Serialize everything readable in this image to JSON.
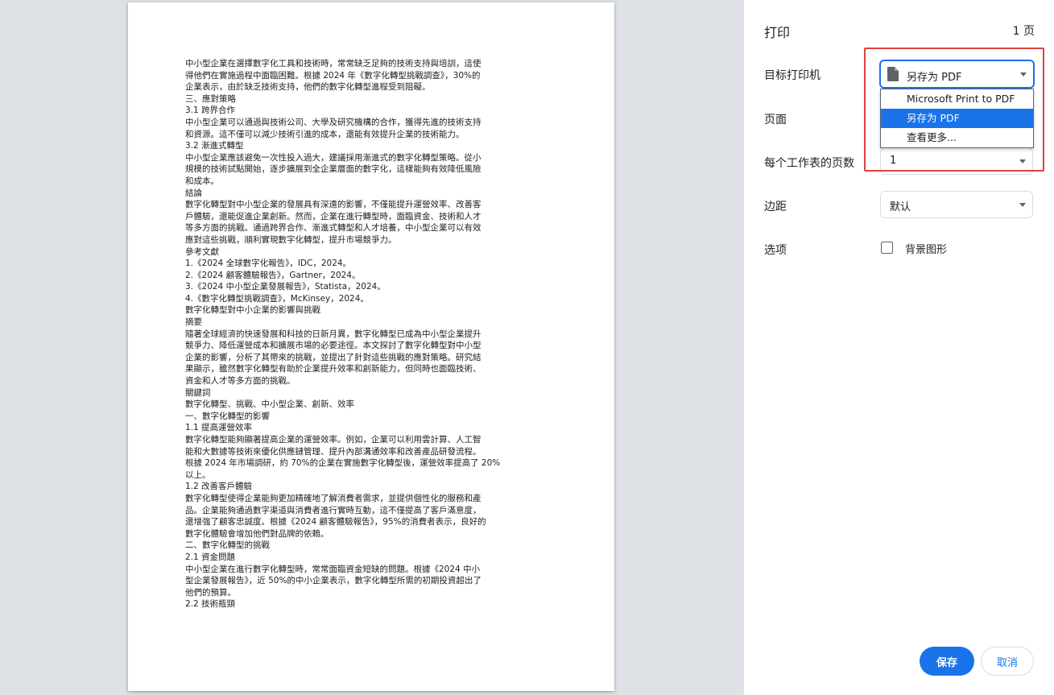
{
  "document": {
    "lines": [
      "中小型企業在選擇數字化工具和技術時，常常缺乏足夠的技術支持與培訓，這使",
      "得他們在實施過程中面臨困難。根據 2024 年《數字化轉型挑戰調查》，30%的",
      "企業表示，由於缺乏技術支持，他們的數字化轉型進程受到阻礙。",
      "三、應對策略",
      "3.1 跨界合作",
      "中小型企業可以通過與技術公司、大學及研究機構的合作，獲得先進的技術支持",
      "和資源。這不僅可以減少技術引進的成本，還能有效提升企業的技術能力。",
      "3.2 漸進式轉型",
      "中小型企業應該避免一次性投入過大，建議採用漸進式的數字化轉型策略。從小",
      "規模的技術試點開始，逐步擴展到全企業層面的數字化，這樣能夠有效降低風險",
      "和成本。",
      "結論",
      "數字化轉型對中小型企業的發展具有深遠的影響，不僅能提升運營效率、改善客",
      "戶體驗，還能促進企業創新。然而，企業在進行轉型時，面臨資金、技術和人才",
      "等多方面的挑戰。通過跨界合作、漸進式轉型和人才培養，中小型企業可以有效",
      "應對這些挑戰，順利實現數字化轉型，提升市場競爭力。",
      "參考文獻",
      "1.《2024 全球數字化報告》，IDC，2024。",
      "2.《2024 顧客體驗報告》，Gartner，2024。",
      "3.《2024 中小型企業發展報告》，Statista，2024。",
      "4.《數字化轉型挑戰調查》，McKinsey，2024。",
      "數字化轉型對中小企業的影響與挑戰",
      "摘要",
      "隨著全球經濟的快速發展和科技的日新月異，數字化轉型已成為中小型企業提升",
      "競爭力、降低運營成本和擴展市場的必要途徑。本文探討了數字化轉型對中小型",
      "企業的影響，分析了其帶來的挑戰，並提出了針對這些挑戰的應對策略。研究結",
      "果顯示，雖然數字化轉型有助於企業提升效率和創新能力，但同時也面臨技術、",
      "資金和人才等多方面的挑戰。",
      "關鍵詞",
      "數字化轉型、挑戰、中小型企業、創新、效率",
      "一、數字化轉型的影響",
      "1.1 提高運營效率",
      "數字化轉型能夠顯著提高企業的運營效率。例如，企業可以利用雲計算、人工智",
      "能和大數據等技術來優化供應鏈管理、提升內部溝通效率和改善產品研發流程。",
      "根據 2024 年市場調研，約 70%的企業在實施數字化轉型後，運營效率提高了 20%",
      "以上。",
      "1.2 改善客戶體驗",
      "數字化轉型使得企業能夠更加精確地了解消費者需求，並提供個性化的服務和產",
      "品。企業能夠通過數字渠道與消費者進行實時互動，這不僅提高了客戶滿意度，",
      "還增強了顧客忠誠度。根據《2024 顧客體驗報告》，95%的消費者表示，良好的",
      "數字化體驗會增加他們對品牌的依賴。",
      "二、數字化轉型的挑戰",
      "2.1 資金問題",
      "中小型企業在進行數字化轉型時，常常面臨資金短缺的問題。根據《2024 中小",
      "型企業發展報告》，近 50%的中小企業表示，數字化轉型所需的初期投資超出了",
      "他們的預算。",
      "2.2 技術瓶頸"
    ]
  },
  "settings": {
    "title": "打印",
    "page_count": "1 页",
    "destination_label": "目标打印机",
    "destination_value": "另存为 PDF",
    "destination_options": [
      "Microsoft Print to PDF",
      "另存为 PDF",
      "查看更多..."
    ],
    "pages_label": "页面",
    "pages_per_sheet_label": "每个工作表的页数",
    "pages_per_sheet_value": "1",
    "margins_label": "边距",
    "margins_value": "默认",
    "options_label": "选项",
    "background_graphics_label": "背景图形",
    "save_label": "保存",
    "cancel_label": "取消"
  },
  "colors": {
    "accent": "#1a73e8",
    "highlight_box": "#e04040"
  }
}
